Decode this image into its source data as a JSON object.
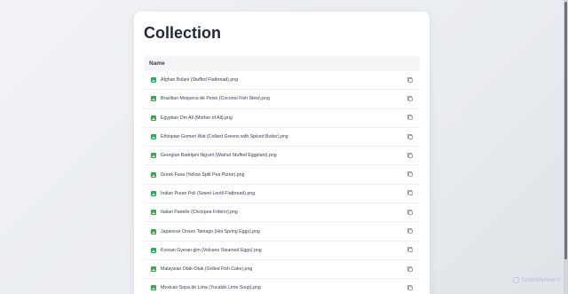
{
  "page": {
    "title": "Collection",
    "column_header": "Name"
  },
  "files": [
    {
      "name": "Afghan Bolani (Stuffed Flatbread).png"
    },
    {
      "name": "Brazilian Moqueca de Peixe (Coconut Fish Stew).png"
    },
    {
      "name": "Egyptian Om Ali (Mother of Ali).png"
    },
    {
      "name": "Ethiopian Gomen Wat (Collard Greens with Spiced Butter).png"
    },
    {
      "name": "Georgian Badrijani Nigvzit (Walnut Stuffed Eggplant).png"
    },
    {
      "name": "Greek Fava (Yellow Split Pea Puree).png"
    },
    {
      "name": "Indian Puran Poli (Sweet Lentil Flatbread).png"
    },
    {
      "name": "Italian Panelle (Chickpea Fritters).png"
    },
    {
      "name": "Japanese Onsen Tamago (Hot Spring Eggs).png"
    },
    {
      "name": "Korean Gyeran-jjim (Volcano Steamed Eggs).png"
    },
    {
      "name": "Malaysian Otak-Otak (Grilled Fish Cake).png"
    },
    {
      "name": "Mexican Sopa de Lima (Yucatán Lime Soup).png"
    }
  ],
  "icons": {
    "file_icon": "image-icon",
    "action_icon": "copy-icon"
  },
  "colors": {
    "file_icon": "#3aa757",
    "header_bg": "#f3f4f6"
  },
  "watermark": {
    "text": "ScanMalware"
  }
}
